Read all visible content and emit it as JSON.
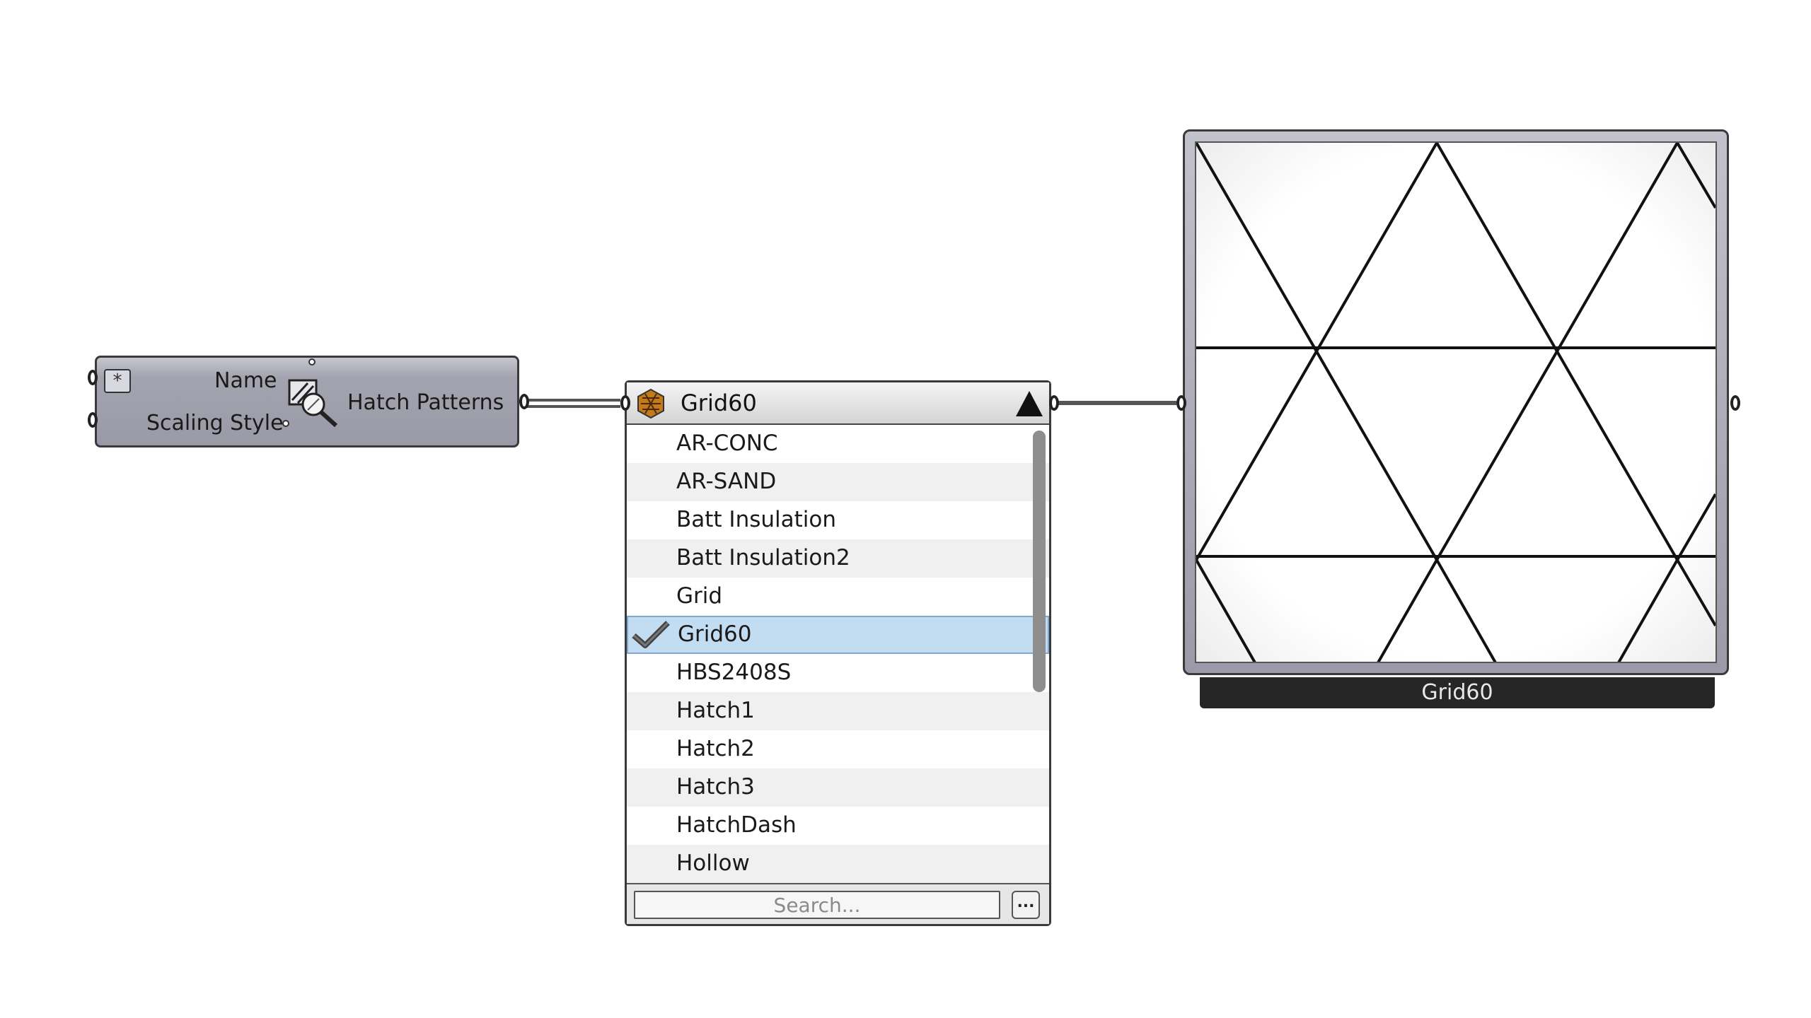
{
  "component": {
    "input_name": "Name",
    "input_scaling": "Scaling Style",
    "output_label": "Hatch Patterns",
    "star_symbol": "*"
  },
  "dropdown": {
    "selected": "Grid60",
    "items": [
      "AR-CONC",
      "AR-SAND",
      "Batt Insulation",
      "Batt Insulation2",
      "Grid",
      "Grid60",
      "HBS2408S",
      "Hatch1",
      "Hatch2",
      "Hatch3",
      "HatchDash",
      "Hollow"
    ],
    "search_placeholder": "Search...",
    "more_label": "..."
  },
  "preview": {
    "caption": "Grid60"
  },
  "icons": {
    "dropdown_header": "hatch-swatch-icon",
    "collapse": "triangle-up-icon",
    "selected": "checkmark-icon",
    "component": "hatch-search-icon"
  },
  "colors": {
    "selection": "#c2dcf2",
    "caption_bg": "#262626"
  }
}
